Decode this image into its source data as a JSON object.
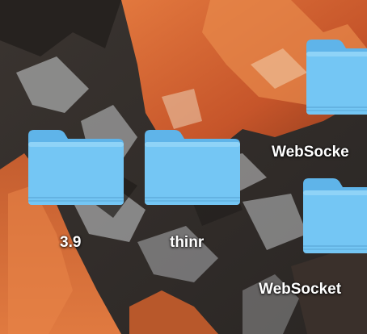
{
  "desktop": {
    "icons": [
      {
        "label": "3.9",
        "icon": "folder-icon"
      },
      {
        "label": "thinr",
        "icon": "folder-icon"
      },
      {
        "label": "WebSocke",
        "icon": "folder-icon"
      },
      {
        "label": "WebSocket",
        "icon": "folder-icon"
      }
    ]
  },
  "colors": {
    "folder_front": "#74c6f4",
    "folder_tab": "#5fb4e9",
    "folder_top": "#8fd3f7",
    "wallpaper_dark": "#2b2826",
    "wallpaper_orange": "#d2642c",
    "label_text": "#ffffff"
  }
}
